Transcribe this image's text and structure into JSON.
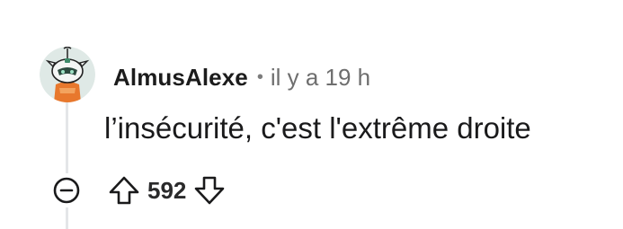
{
  "comment": {
    "username": "AlmusAlexe",
    "separator": "•",
    "timestamp": "il y a 19 h",
    "text": "l’insécurité, c'est l'extrême droite",
    "score": "592",
    "avatar_icon": "snoo-avatar-icon",
    "collapse_icon": "collapse-minus-icon",
    "upvote_icon": "upvote-arrow-icon",
    "downvote_icon": "downvote-arrow-icon"
  },
  "colors": {
    "text": "#1a1a1b",
    "muted": "#6e6e6e",
    "thread_line": "#e4e6e8",
    "avatar_bg": "#d9e8e4",
    "avatar_accent": "#e8782d"
  }
}
